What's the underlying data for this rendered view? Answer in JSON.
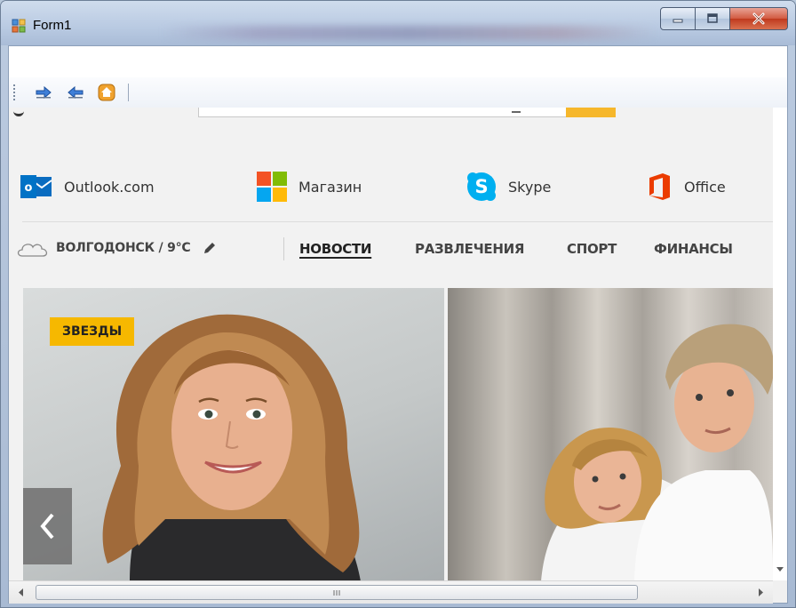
{
  "window": {
    "title": "Form1"
  },
  "toolbar": {
    "buttons": [
      {
        "icon": "forward-arrow-icon",
        "tooltip": ""
      },
      {
        "icon": "back-arrow-icon",
        "tooltip": ""
      },
      {
        "icon": "home-icon",
        "tooltip": ""
      }
    ]
  },
  "quick_links": [
    {
      "label": "Outlook.com",
      "icon": "outlook-icon"
    },
    {
      "label": "Магазин",
      "icon": "store-icon"
    },
    {
      "label": "Skype",
      "icon": "skype-icon"
    },
    {
      "label": "Office",
      "icon": "office-icon"
    }
  ],
  "weather": {
    "location_temp": "ВОЛГОДОНСК / 9°C"
  },
  "nav": {
    "items": [
      {
        "label": "НОВОСТИ",
        "active": true
      },
      {
        "label": "РАЗВЛЕЧЕНИЯ",
        "active": false
      },
      {
        "label": "СПОРТ",
        "active": false
      },
      {
        "label": "ФИНАНСЫ",
        "active": false
      }
    ]
  },
  "hero": {
    "badge": "ЗВЕЗДЫ"
  },
  "colors": {
    "accent_yellow": "#f6b800",
    "search_button": "#f6b72b",
    "outlook_blue": "#0072c6",
    "skype_blue": "#00aff0",
    "office_orange": "#eb3c00"
  }
}
